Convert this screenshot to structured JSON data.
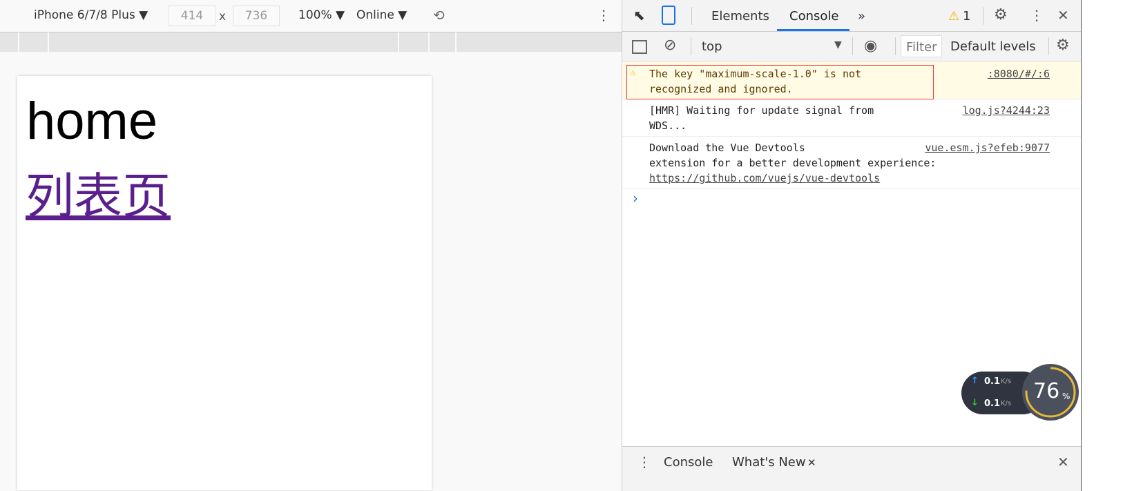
{
  "device_toolbar": {
    "device": "iPhone 6/7/8 Plus",
    "width": "414",
    "x": "x",
    "height": "736",
    "zoom": "100%",
    "network": "Online"
  },
  "page": {
    "heading": "home",
    "link": "列表页"
  },
  "devtools": {
    "tabs": [
      "Elements",
      "Console"
    ],
    "more": "»",
    "warning_count": "1",
    "context": "top",
    "filter_placeholder": "Filter",
    "levels": "Default levels",
    "messages": [
      {
        "level": "warning",
        "text": "The key \"maximum-scale-1.0\" is not\nrecognized and ignored.",
        "source": ":8080/#/:6"
      },
      {
        "level": "info",
        "text": "[HMR] Waiting for update signal from\nWDS...",
        "source": "log.js?4244:23"
      },
      {
        "level": "info",
        "text": "Download the Vue Devtools\nextension for a better development experience:",
        "link": "https://github.com/vuejs/vue-devtools",
        "source": "vue.esm.js?efeb:9077"
      }
    ],
    "prompt": "›",
    "drawer_tabs": [
      "Console",
      "What's New"
    ]
  },
  "net_widget": {
    "upload": "0.1",
    "download": "0.1",
    "unit": "K/s",
    "percent": "76",
    "percent_sign": "%",
    "percent_value": 76
  }
}
